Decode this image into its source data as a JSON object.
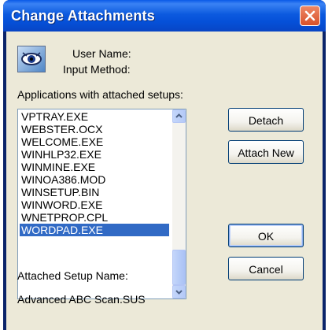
{
  "window": {
    "title": "Change Attachments"
  },
  "info": {
    "user_name_label": "User Name:",
    "input_method_label": "Input Method:"
  },
  "list": {
    "label": "Applications with attached setups:",
    "items": [
      "VPTRAY.EXE",
      "WEBSTER.OCX",
      "WELCOME.EXE",
      "WINHLP32.EXE",
      "WINMINE.EXE",
      "WINOA386.MOD",
      "WINSETUP.BIN",
      "WINWORD.EXE",
      "WNETPROP.CPL",
      "WORDPAD.EXE"
    ],
    "selected": "WORDPAD.EXE"
  },
  "buttons": {
    "detach": "Detach",
    "attach_new": "Attach New",
    "ok": "OK",
    "cancel": "Cancel"
  },
  "attached": {
    "label": "Attached Setup Name:",
    "value": "Advanced ABC Scan.SUS"
  },
  "icons": {
    "app": "eye-icon",
    "close": "close-icon",
    "scroll_up": "scroll-up-arrow-icon",
    "scroll_down": "scroll-down-arrow-icon"
  },
  "colors": {
    "title_bar": "#0a5ae8",
    "close_button": "#d8512a",
    "selection": "#316ac5",
    "dialog_face": "#ece9d8"
  }
}
